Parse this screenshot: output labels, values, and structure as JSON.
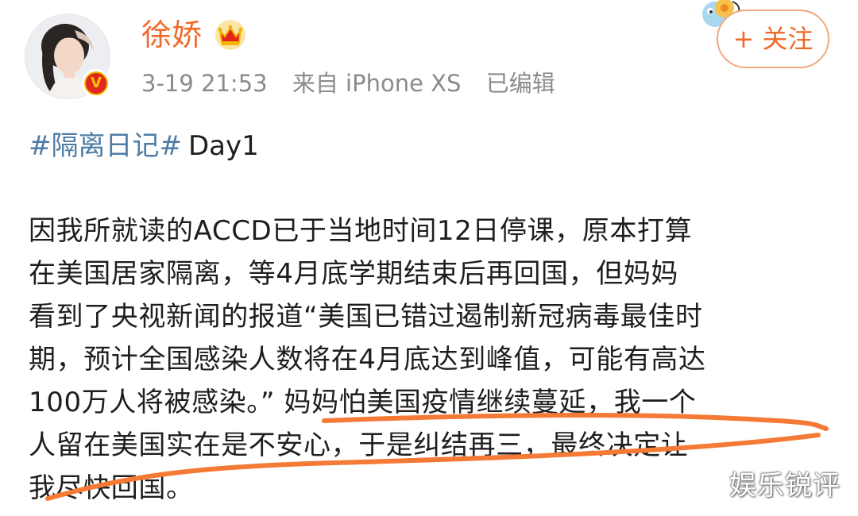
{
  "header": {
    "username": "徐娇",
    "timestamp": "3-19 21:53",
    "source": "来自 iPhone XS",
    "edited": "已编辑",
    "follow_label": "+ 关注"
  },
  "post": {
    "topic": "#隔离日记#",
    "topic_suffix": "Day1",
    "lines": [
      "因我所就读的ACCD已于当地时间12日停课，原本打算",
      "在美国居家隔离，等4月底学期结束后再回国，但妈妈",
      "看到了央视新闻的报道“美国已错过遏制新冠病毒最佳时",
      "期，预计全国感染人数将在4月底达到峰值，可能有高达",
      "100万人将被感染。” 妈妈怕美国疫情继续蔓延，我一个",
      "人留在美国实在是不安心，于是纠结再三，最终决定让",
      "我尽快回国。"
    ]
  },
  "watermark": "娱乐锐评",
  "icons": {
    "verified": "verified-v-icon",
    "crown": "crown-icon",
    "avatar": "avatar-portrait"
  },
  "colors": {
    "username": "#f26a2a",
    "topic": "#4d7ca6",
    "follow_border": "#f0a97f",
    "underline": "#f47a35"
  }
}
